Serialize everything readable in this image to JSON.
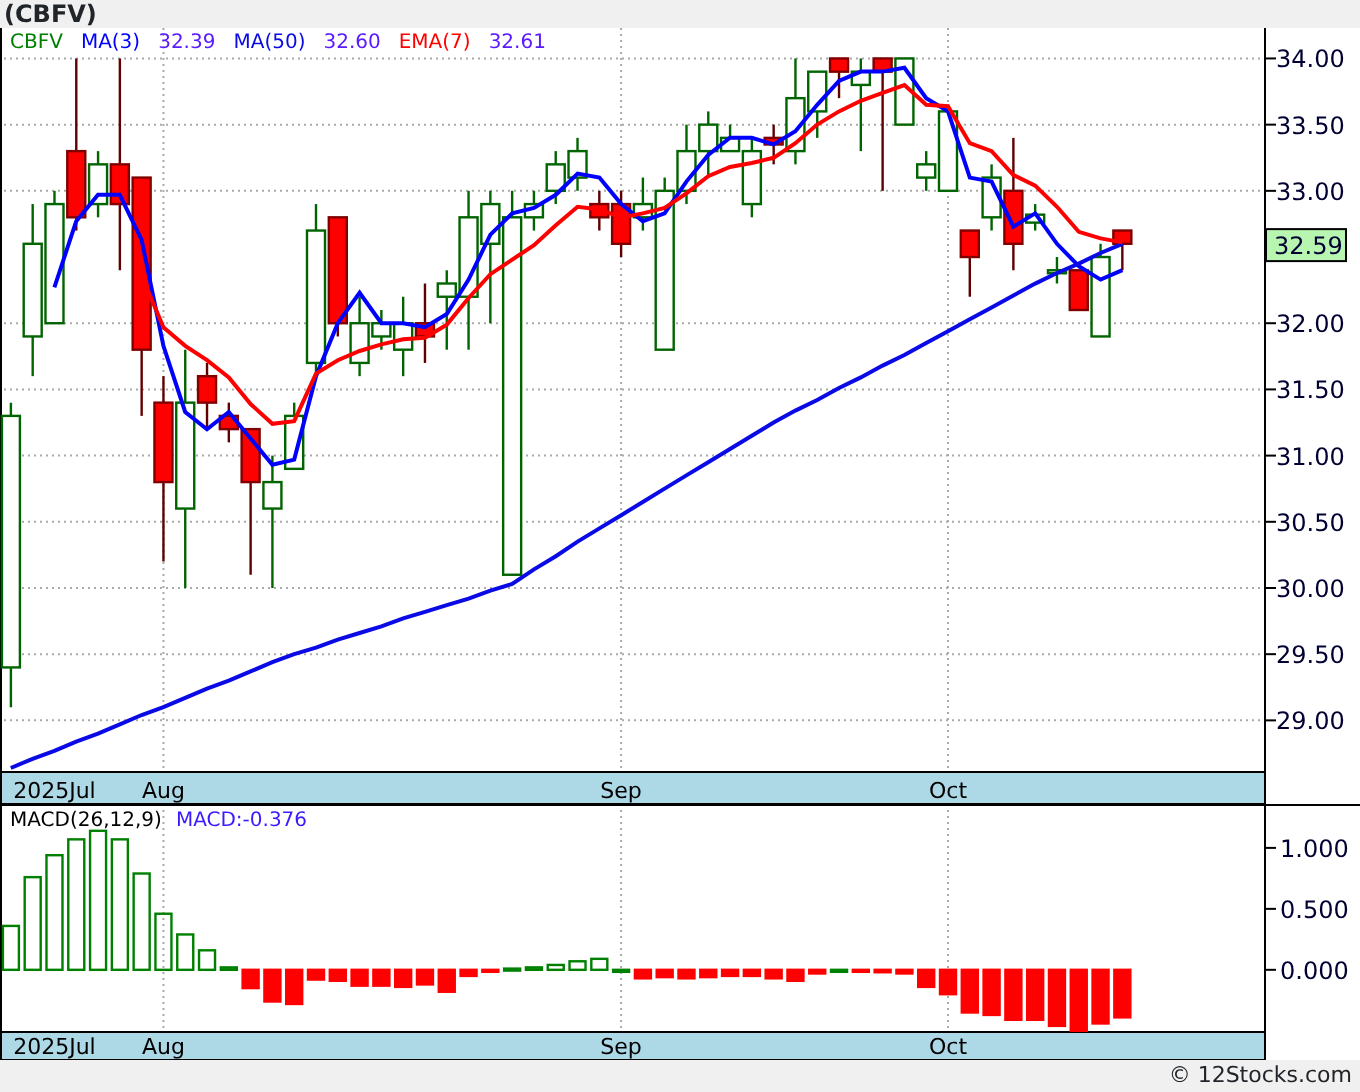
{
  "title": "(CBFV)",
  "price_panel": {
    "legend": {
      "symbol": "CBFV",
      "readings": [
        "32.39",
        "32.60",
        "32.61"
      ]
    },
    "last_price": "32.59",
    "chart_data": {
      "type": "candlestick",
      "ylim": [
        28.61,
        34.23
      ],
      "grid": true,
      "categories": [
        null,
        null,
        "2025Jul",
        null,
        null,
        null,
        null,
        "Aug",
        null,
        null,
        null,
        null,
        null,
        null,
        null,
        null,
        null,
        null,
        null,
        null,
        null,
        null,
        null,
        null,
        null,
        null,
        null,
        null,
        "Sep",
        null,
        null,
        null,
        null,
        null,
        null,
        null,
        null,
        null,
        null,
        null,
        null,
        null,
        null,
        "Oct",
        null,
        null,
        null,
        null,
        null,
        null,
        null,
        null,
        null,
        null,
        null,
        null,
        null,
        null
      ],
      "yticks": [
        {
          "value": 29,
          "label": "29.00"
        },
        {
          "value": 29.5,
          "label": "29.50"
        },
        {
          "value": 30,
          "label": "30.00"
        },
        {
          "value": 30.5,
          "label": "30.50"
        },
        {
          "value": 31,
          "label": "31.00"
        },
        {
          "value": 31.5,
          "label": "31.50"
        },
        {
          "value": 32,
          "label": "32.00"
        },
        {
          "value": 33,
          "label": "33.00"
        },
        {
          "value": 33.5,
          "label": "33.50"
        },
        {
          "value": 34,
          "label": "34.00"
        }
      ],
      "ohlc": [
        [
          29.4,
          31.4,
          29.1,
          31.3
        ],
        [
          31.9,
          32.9,
          31.6,
          32.6
        ],
        [
          32.0,
          33.0,
          32.0,
          32.9
        ],
        [
          33.3,
          34.0,
          32.7,
          32.8
        ],
        [
          32.9,
          33.3,
          32.8,
          33.2
        ],
        [
          33.2,
          34.0,
          32.4,
          32.9
        ],
        [
          33.1,
          33.1,
          31.3,
          31.8
        ],
        [
          31.4,
          31.6,
          30.2,
          30.8
        ],
        [
          30.6,
          31.8,
          30.0,
          31.4
        ],
        [
          31.6,
          31.7,
          31.2,
          31.4
        ],
        [
          31.3,
          31.4,
          31.1,
          31.2
        ],
        [
          31.2,
          31.2,
          30.1,
          30.8
        ],
        [
          30.6,
          31.0,
          30.0,
          30.8
        ],
        [
          30.9,
          31.4,
          30.9,
          31.3
        ],
        [
          31.7,
          32.9,
          31.6,
          32.7
        ],
        [
          32.8,
          32.8,
          31.9,
          32.0
        ],
        [
          31.7,
          32.2,
          31.6,
          32.0
        ],
        [
          31.9,
          32.1,
          31.8,
          32.0
        ],
        [
          31.8,
          32.2,
          31.6,
          32.0
        ],
        [
          32.0,
          32.3,
          31.7,
          31.9
        ],
        [
          32.2,
          32.4,
          31.8,
          32.3
        ],
        [
          32.2,
          33.0,
          31.8,
          32.8
        ],
        [
          32.6,
          33.0,
          32.0,
          32.9
        ],
        [
          30.1,
          33.0,
          30.1,
          32.8
        ],
        [
          32.8,
          33.0,
          32.7,
          32.9
        ],
        [
          33.0,
          33.3,
          32.9,
          33.2
        ],
        [
          33.1,
          33.4,
          33.0,
          33.3
        ],
        [
          32.9,
          33.0,
          32.7,
          32.8
        ],
        [
          32.9,
          33.0,
          32.5,
          32.6
        ],
        [
          32.8,
          33.1,
          32.7,
          32.9
        ],
        [
          31.8,
          33.1,
          31.8,
          33.0
        ],
        [
          33.0,
          33.5,
          32.9,
          33.3
        ],
        [
          33.3,
          33.6,
          33.1,
          33.5
        ],
        [
          33.3,
          33.5,
          33.3,
          33.4
        ],
        [
          32.9,
          33.4,
          32.8,
          33.3
        ],
        [
          33.4,
          33.5,
          33.2,
          33.35
        ],
        [
          33.3,
          34.0,
          33.2,
          33.7
        ],
        [
          33.6,
          33.9,
          33.4,
          33.9
        ],
        [
          34.0,
          34.0,
          33.7,
          33.9
        ],
        [
          33.8,
          34.0,
          33.3,
          33.9
        ],
        [
          34.0,
          34.0,
          33.0,
          33.9
        ],
        [
          33.5,
          34.0,
          33.5,
          34.0
        ],
        [
          33.1,
          33.3,
          33.0,
          33.2
        ],
        [
          33.0,
          33.6,
          33.0,
          33.6
        ],
        [
          32.7,
          32.7,
          32.2,
          32.5
        ],
        [
          32.8,
          33.2,
          32.7,
          33.1
        ],
        [
          33.0,
          33.4,
          32.4,
          32.6
        ],
        [
          32.76,
          32.9,
          32.7,
          32.82
        ],
        [
          32.4,
          32.5,
          32.3,
          32.4
        ],
        [
          32.4,
          32.4,
          32.1,
          32.1
        ],
        [
          31.9,
          32.6,
          31.9,
          32.5
        ],
        [
          32.7,
          32.7,
          32.4,
          32.6
        ],
        null,
        null,
        null,
        null,
        null,
        null
      ],
      "series": [
        {
          "name": "MA(3)",
          "type": "line",
          "color": "#0000ff",
          "values": [
            null,
            null,
            32.27,
            32.77,
            32.97,
            32.97,
            32.63,
            31.83,
            31.33,
            31.2,
            31.33,
            31.13,
            30.93,
            30.97,
            31.6,
            32.0,
            32.23,
            32.0,
            32.0,
            31.97,
            32.07,
            32.33,
            32.67,
            32.83,
            32.87,
            32.97,
            33.13,
            33.1,
            32.9,
            32.77,
            32.83,
            33.07,
            33.27,
            33.4,
            33.4,
            33.35,
            33.45,
            33.65,
            33.83,
            33.9,
            33.9,
            33.93,
            33.7,
            33.6,
            33.1,
            33.07,
            32.73,
            32.83,
            32.6,
            32.43,
            32.33,
            32.4,
            null,
            null,
            null,
            null,
            null,
            null
          ]
        },
        {
          "name": "MA(50)",
          "type": "line",
          "color": "#0a0ae6",
          "values": [
            28.64,
            28.71,
            28.77,
            28.84,
            28.9,
            28.97,
            29.04,
            29.1,
            29.17,
            29.24,
            29.3,
            29.37,
            29.44,
            29.5,
            29.55,
            29.61,
            29.66,
            29.71,
            29.77,
            29.82,
            29.87,
            29.92,
            29.98,
            30.03,
            30.14,
            30.24,
            30.35,
            30.45,
            30.55,
            30.65,
            30.75,
            30.85,
            30.95,
            31.05,
            31.15,
            31.25,
            31.34,
            31.42,
            31.51,
            31.59,
            31.68,
            31.76,
            31.85,
            31.94,
            32.03,
            32.12,
            32.21,
            32.3,
            32.38,
            32.45,
            32.53,
            32.6,
            null,
            null,
            null,
            null,
            null,
            null
          ]
        },
        {
          "name": "EMA(7)",
          "type": "line",
          "color": "#ff0000",
          "values": [
            null,
            null,
            null,
            null,
            null,
            null,
            32.36,
            31.97,
            31.83,
            31.72,
            31.59,
            31.39,
            31.24,
            31.26,
            31.62,
            31.72,
            31.79,
            31.84,
            31.88,
            31.89,
            31.99,
            32.19,
            32.37,
            32.48,
            32.59,
            32.74,
            32.88,
            32.86,
            32.8,
            32.83,
            32.87,
            32.98,
            33.11,
            33.18,
            33.21,
            33.25,
            33.36,
            33.5,
            33.6,
            33.68,
            33.74,
            33.8,
            33.65,
            33.64,
            33.36,
            33.3,
            33.12,
            33.04,
            32.88,
            32.69,
            32.64,
            32.61,
            null,
            null,
            null,
            null,
            null,
            null
          ]
        }
      ]
    }
  },
  "macd_panel": {
    "legend": {
      "reading": "MACD:-0.376"
    },
    "chart_data": {
      "type": "bar",
      "ylim": [
        -0.51,
        1.36
      ],
      "grid": true,
      "categories": [
        null,
        null,
        "2025Jul",
        null,
        null,
        null,
        null,
        "Aug",
        null,
        null,
        null,
        null,
        null,
        null,
        null,
        null,
        null,
        null,
        null,
        null,
        null,
        null,
        null,
        null,
        null,
        null,
        null,
        null,
        "Sep",
        null,
        null,
        null,
        null,
        null,
        null,
        null,
        null,
        null,
        null,
        null,
        null,
        null,
        null,
        "Oct",
        null,
        null,
        null,
        null,
        null,
        null,
        null,
        null,
        null,
        null,
        null,
        null,
        null,
        null
      ],
      "yticks": [
        {
          "value": 0,
          "label": "0.000"
        },
        {
          "value": 0.5,
          "label": "0.500"
        },
        {
          "value": 1,
          "label": "1.000"
        }
      ],
      "series": [
        {
          "name": "MACD(26,12,9)",
          "color": "#008000",
          "values": [
            0.36,
            0.76,
            0.94,
            1.07,
            1.14,
            1.07,
            0.79,
            0.46,
            0.29,
            0.16,
            0.02,
            null,
            null,
            null,
            null,
            null,
            null,
            null,
            null,
            null,
            null,
            null,
            null,
            0.01,
            0.02,
            0.04,
            0.07,
            0.09,
            0.0,
            null,
            null,
            null,
            null,
            null,
            null,
            null,
            null,
            null,
            0.0,
            null,
            null,
            null,
            null,
            null,
            null,
            null,
            null,
            null,
            null,
            null,
            null,
            null,
            null,
            null,
            null,
            null,
            null,
            null
          ]
        },
        {
          "color": "#ff0000",
          "values": [
            null,
            null,
            null,
            null,
            null,
            null,
            null,
            null,
            null,
            null,
            null,
            -0.15,
            -0.26,
            -0.28,
            -0.08,
            -0.09,
            -0.13,
            -0.13,
            -0.14,
            -0.12,
            -0.18,
            -0.05,
            -0.01,
            null,
            null,
            null,
            null,
            null,
            null,
            -0.07,
            -0.06,
            -0.07,
            -0.06,
            -0.05,
            -0.05,
            -0.07,
            -0.09,
            -0.03,
            null,
            -0.01,
            -0.02,
            -0.03,
            -0.14,
            -0.2,
            -0.35,
            -0.37,
            -0.41,
            -0.41,
            -0.46,
            -0.5,
            -0.44,
            -0.39,
            null,
            null,
            null,
            null,
            null,
            null
          ]
        }
      ]
    }
  },
  "footer": "© 12Stocks.com"
}
